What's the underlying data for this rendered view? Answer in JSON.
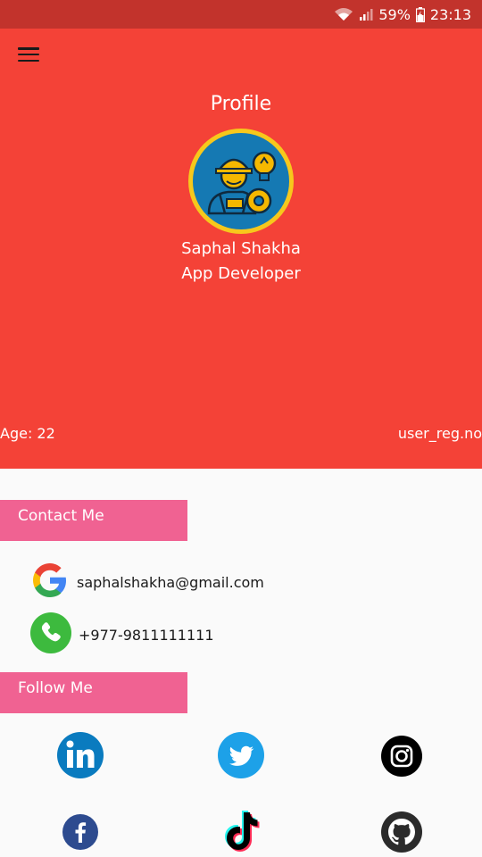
{
  "status_bar": {
    "battery": "59%",
    "time": "23:13"
  },
  "header": {
    "title": "Profile",
    "name": "Saphal Shakha",
    "role": "App Developer",
    "age": "Age: 22",
    "reg": "user_reg.no"
  },
  "contact": {
    "title": "Contact Me",
    "email": "saphalshakha@gmail.com",
    "phone": "+977-9811111111"
  },
  "follow": {
    "title": "Follow Me"
  },
  "colors": {
    "header": "#f44237",
    "status_bar": "#c2332c",
    "section_tab": "#f06292",
    "avatar_ring": "#f7c81c"
  }
}
